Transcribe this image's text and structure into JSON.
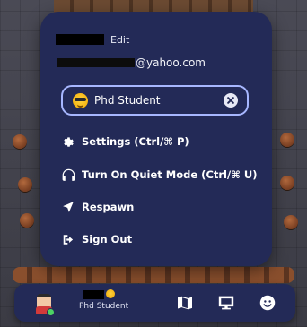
{
  "menu": {
    "edit_label": "Edit",
    "email_suffix": "@yahoo.com",
    "status_value": "Phd Student",
    "items": [
      {
        "label": "Settings (Ctrl/⌘ P)",
        "icon": "gear-icon"
      },
      {
        "label": "Turn On Quiet Mode (Ctrl/⌘ U)",
        "icon": "headphones-icon"
      },
      {
        "label": "Respawn",
        "icon": "location-arrow-icon"
      },
      {
        "label": "Sign Out",
        "icon": "sign-out-icon"
      }
    ]
  },
  "bottom_bar": {
    "status_text": "Phd Student",
    "status_emoji": "sunglasses-emoji-icon",
    "icons": [
      "map-icon",
      "screen-share-icon",
      "emoji-reaction-icon"
    ],
    "online_indicator_color": "#4cd264"
  },
  "colors": {
    "panel_bg": "#232a57",
    "input_border": "#a7b7ff"
  }
}
